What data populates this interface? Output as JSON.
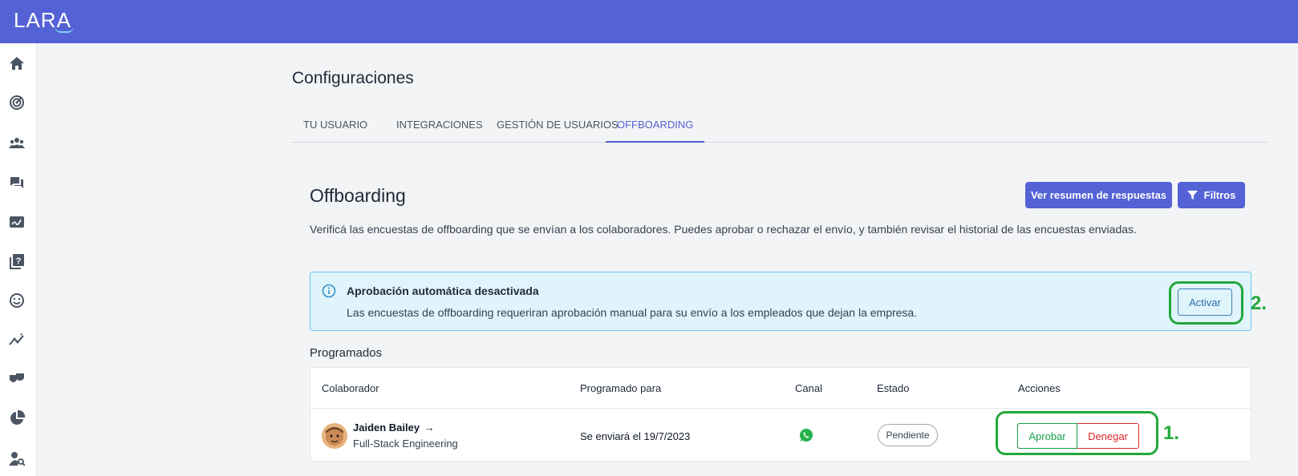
{
  "app": {
    "logo": "LARA"
  },
  "sidebar": {
    "icons": [
      "home-icon",
      "radar-icon",
      "people-icon",
      "chat-icon",
      "signature-icon",
      "help-book-icon",
      "smile-icon",
      "trend-icon",
      "masks-icon",
      "pie-chart-icon",
      "user-search-icon"
    ]
  },
  "page": {
    "title": "Configuraciones"
  },
  "tabs": [
    {
      "label": "TU USUARIO"
    },
    {
      "label": "INTEGRACIONES"
    },
    {
      "label": "GESTIÓN DE USUARIOS"
    },
    {
      "label": "OFFBOARDING",
      "active": true
    }
  ],
  "offboarding": {
    "title": "Offboarding",
    "description": "Verificá las encuestas de offboarding que se envían a los colaboradores. Puedes aprobar o rechazar el envío, y también revisar el historial de las encuestas enviadas.",
    "summary_button": "Ver resumen de respuestas",
    "filters_button": "Filtros"
  },
  "alert": {
    "title": "Aprobación automática desactivada",
    "text": "Las encuestas de offboarding requeriran aprobación manual para su envío a los empleados que dejan la empresa.",
    "button": "Activar"
  },
  "annotations": {
    "one": "1.",
    "two": "2."
  },
  "scheduled": {
    "title": "Programados",
    "headers": {
      "collaborator": "Colaborador",
      "scheduled_for": "Programado para",
      "channel": "Canal",
      "status": "Estado",
      "actions": "Acciones"
    },
    "rows": [
      {
        "name": "Jaiden Bailey",
        "role": "Full-Stack Engineering",
        "scheduled": "Se enviará el 19/7/2023",
        "channel_icon": "whatsapp-icon",
        "status": "Pendiente",
        "approve": "Aprobar",
        "deny": "Denegar"
      }
    ]
  },
  "colors": {
    "brand": "#5462d6",
    "highlight": "#22a83b",
    "info_bg": "#e0f4fb",
    "approve": "#16a34a",
    "deny": "#dc2626"
  }
}
